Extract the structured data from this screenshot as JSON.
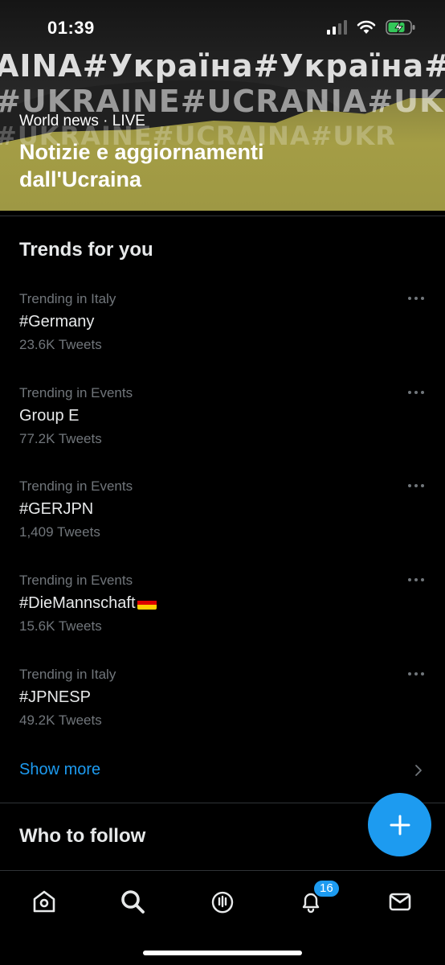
{
  "status_bar": {
    "time": "01:39"
  },
  "hero": {
    "bg_lines": [
      "AINA#Україна#Україна#",
      "#UKRAINE#UCRANIA#UKRAINE",
      "#UKRAINE#UCRAINA#UKR"
    ],
    "subtitle": "World news · LIVE",
    "title": "Notizie e aggiornamenti dall'Ucraina"
  },
  "trends": {
    "title": "Trends for you",
    "items": [
      {
        "meta": "Trending in Italy",
        "name": "#Germany",
        "count": "23.6K Tweets"
      },
      {
        "meta": "Trending in Events",
        "name": "Group E",
        "count": "77.2K Tweets"
      },
      {
        "meta": "Trending in Events",
        "name": "#GERJPN",
        "count": "1,409 Tweets"
      },
      {
        "meta": "Trending in Events",
        "name": "#DieMannschaft",
        "count": "15.6K Tweets",
        "emoji": "german-flag"
      },
      {
        "meta": "Trending in Italy",
        "name": "#JPNESP",
        "count": "49.2K Tweets"
      }
    ],
    "show_more": "Show more"
  },
  "who_to_follow": {
    "title": "Who to follow"
  },
  "tabbar": {
    "items": [
      "home-icon",
      "search-icon",
      "spaces-icon",
      "notifications-icon",
      "messages-icon"
    ],
    "notifications_badge": "16"
  },
  "colors": {
    "accent": "#1d9bf0",
    "background": "#000000",
    "secondary_text": "#71767b",
    "primary_text": "#e7e9ea"
  }
}
